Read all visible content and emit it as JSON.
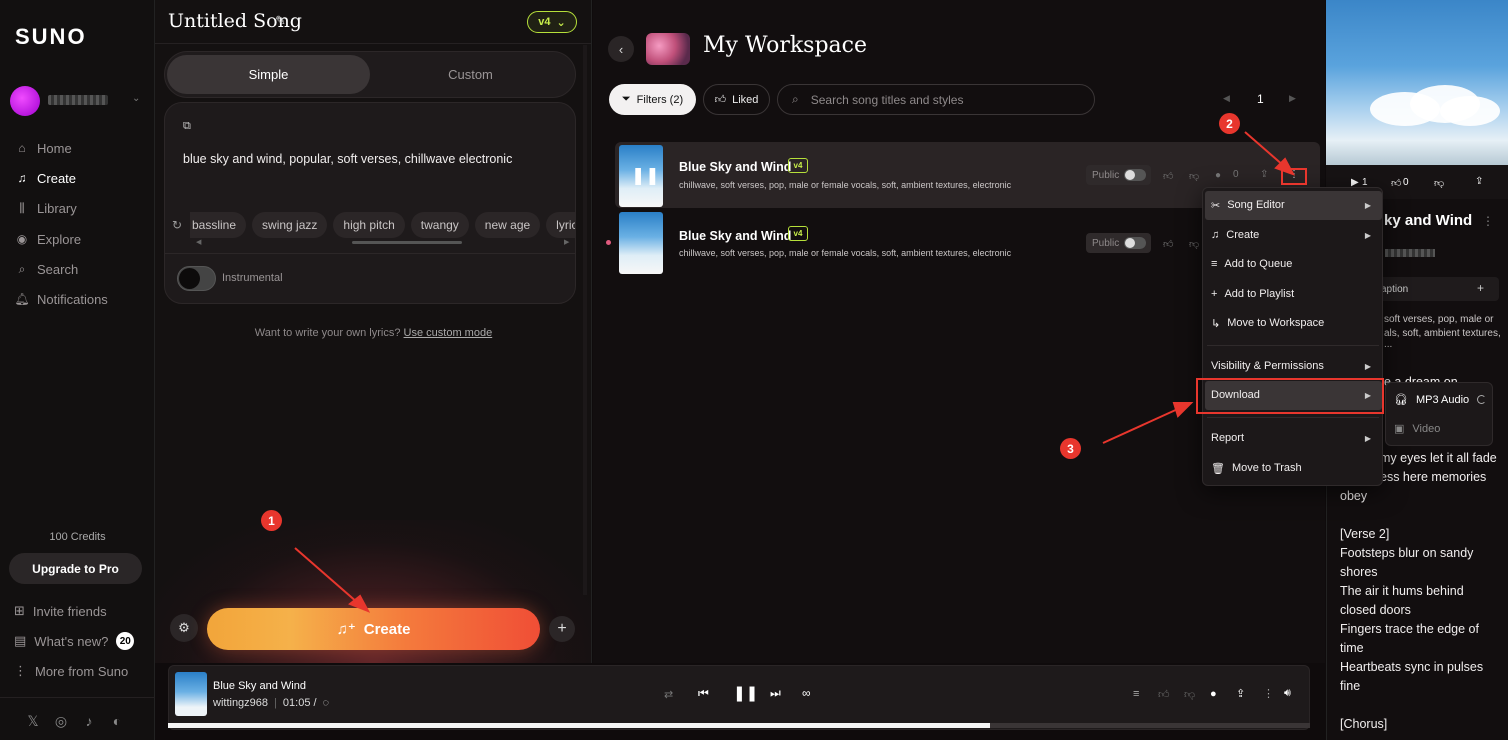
{
  "app": {
    "logo": "SUNO"
  },
  "sidebar": {
    "nav": [
      {
        "label": "Home",
        "icon": "home-icon"
      },
      {
        "label": "Create",
        "icon": "music-note-icon"
      },
      {
        "label": "Library",
        "icon": "library-icon"
      },
      {
        "label": "Explore",
        "icon": "compass-icon"
      },
      {
        "label": "Search",
        "icon": "search-icon"
      },
      {
        "label": "Notifications",
        "icon": "bell-icon"
      }
    ],
    "credits": "100 Credits",
    "upgrade_label": "Upgrade to Pro",
    "invite_label": "Invite friends",
    "whats_new_label": "What's new?",
    "whats_new_count": "20",
    "more_label": "More from Suno"
  },
  "create_panel": {
    "song_title": "Untitled Song",
    "version": "v4",
    "mode_simple": "Simple",
    "mode_custom": "Custom",
    "prompt": "blue sky and wind, popular, soft verses, chillwave electronic",
    "chips": [
      "bassline",
      "swing jazz",
      "high pitch",
      "twangy",
      "new age",
      "lyrical"
    ],
    "instrumental_label": "Instrumental",
    "lyrics_hint": "Want to write your own lyrics?",
    "lyrics_hint_link": "Use custom mode",
    "create_label": "Create"
  },
  "workspace": {
    "title": "My Workspace",
    "filters_label": "Filters (2)",
    "liked_label": "Liked",
    "search_placeholder": "Search song titles and styles",
    "page": "1",
    "songs": [
      {
        "title": "Blue Sky and Wind",
        "version": "v4",
        "tags": "chillwave, soft verses, pop, male or female vocals, soft, ambient textures, electronic",
        "public_label": "Public",
        "comments": "0"
      },
      {
        "title": "Blue Sky and Wind",
        "version": "v4",
        "tags": "chillwave, soft verses, pop, male or female vocals, soft, ambient textures, electronic",
        "public_label": "Public"
      }
    ]
  },
  "context_menu": {
    "items": [
      "Song Editor",
      "Create",
      "Add to Queue",
      "Add to Playlist",
      "Move to Workspace",
      "Visibility & Permissions",
      "Download",
      "Report",
      "Move to Trash"
    ],
    "download_submenu": [
      "MP3 Audio",
      "Video"
    ]
  },
  "annotations": {
    "step1": "1",
    "step2": "2",
    "step3": "3",
    "color": "#e8362d"
  },
  "right_panel": {
    "likes": "1",
    "dislikes": "0",
    "title": "ky and Wind",
    "caption_label": "aption",
    "tags_line1": "soft verses, pop, male or",
    "tags_line2": "als, soft, ambient textures, ...",
    "lyric_partial": "e a dream on",
    "lyrics": [
      "my eyes let it all fade",
      "ess here memories",
      "obey",
      "",
      "[Verse 2]",
      "Footsteps blur on sandy",
      "shores",
      "The air it hums behind",
      "closed doors",
      "Fingers trace the edge of",
      "time",
      "Heartbeats sync in pulses",
      "fine",
      "",
      "[Chorus]"
    ]
  },
  "player": {
    "title": "Blue Sky and Wind",
    "artist": "wittingz968",
    "time": "01:05 /",
    "progress": 0.72
  }
}
